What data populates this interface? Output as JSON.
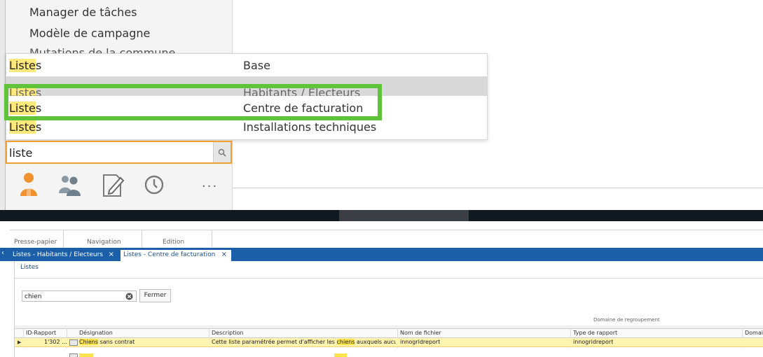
{
  "nav_menu": {
    "items": [
      "Manager de tâches",
      "Modèle de campagne",
      "Mutations de la commune"
    ]
  },
  "search_results": [
    {
      "prefix": "Liste",
      "suffix": "s",
      "category": "Base"
    },
    {
      "prefix": "Liste",
      "suffix": "s",
      "category": "Habitants / Electeurs"
    },
    {
      "prefix": "Liste",
      "suffix": "s",
      "category": "Centre de facturation"
    },
    {
      "prefix": "Liste",
      "suffix": "s",
      "category": "Installations techniques"
    }
  ],
  "nav_search": {
    "value": "liste"
  },
  "nav_icons": {
    "more": "···",
    "names": [
      "user-icon",
      "group-icon",
      "edit-icon",
      "clock-icon",
      "more-icon"
    ]
  },
  "ribbon": {
    "tabs": [
      "Presse-papier",
      "Navigation",
      "Edition"
    ]
  },
  "doc_tabs": [
    {
      "label": "Listes - Habitants / Electeurs",
      "close": "×"
    },
    {
      "label": "Listes - Centre de facturation",
      "close": "×"
    }
  ],
  "breadcrumb": "Listes",
  "filter": {
    "value": "chien",
    "close_button": "Fermer"
  },
  "grouping_label": "Domaine de regroupement",
  "grid": {
    "columns": [
      "ID-Rapport",
      "Désignation",
      "Description",
      "Nom de fichier",
      "Type de rapport",
      "Domaine"
    ],
    "rows": [
      {
        "id": "1'302",
        "id_more": "...",
        "designation_hl": "Chiens",
        "designation_rest": " sans contrat",
        "description_a": "Cette liste paramétrée permet d'afficher les ",
        "description_hl": "chiens",
        "description_b": " auxquels aucun c...",
        "file_name": "innogridreport",
        "report_type": "innogridreport"
      }
    ]
  },
  "colors": {
    "accent_blue": "#1a5fa8",
    "highlight": "#ffe34d",
    "green_frame": "#5fc43a",
    "orange_border": "#f0a030"
  }
}
